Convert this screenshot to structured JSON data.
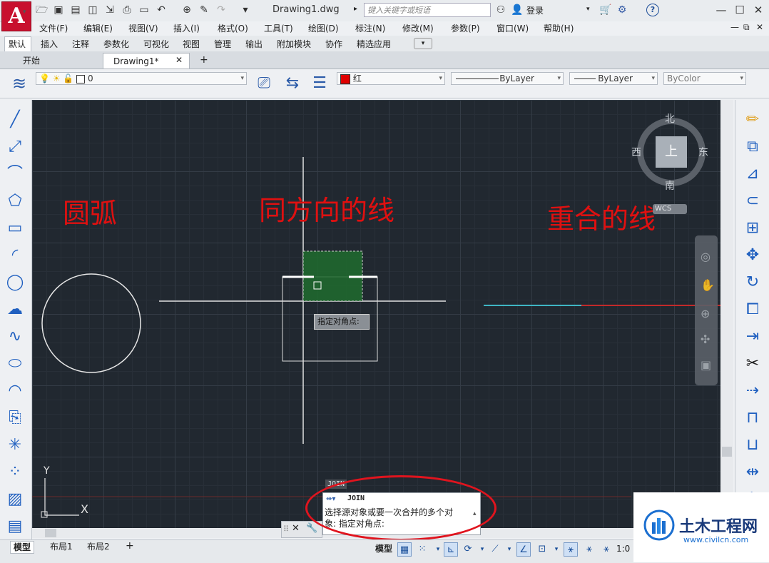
{
  "window": {
    "doc_title": "Drawing1.dwg",
    "search_placeholder": "键入关键字或短语",
    "login": "登录",
    "help": "?"
  },
  "app_logo": "A",
  "menu": [
    "文件(F)",
    "编辑(E)",
    "视图(V)",
    "插入(I)",
    "格式(O)",
    "工具(T)",
    "绘图(D)",
    "标注(N)",
    "修改(M)",
    "参数(P)",
    "窗口(W)",
    "帮助(H)"
  ],
  "ribbon_tabs": [
    "默认",
    "插入",
    "注释",
    "参数化",
    "可视化",
    "视图",
    "管理",
    "输出",
    "附加模块",
    "协作",
    "精选应用"
  ],
  "file_tabs": {
    "start": "开始",
    "drawing": "Drawing1*",
    "new_tab": "+"
  },
  "properties": {
    "layer": "0",
    "color": "红",
    "color_swatch": "#e00000",
    "linetype": "ByLayer",
    "lineweight": "ByLayer",
    "plotstyle": "ByColor"
  },
  "canvas": {
    "label_arc": "圆弧",
    "label_same_direction": "同方向的线",
    "label_overlap": "重合的线",
    "tooltip": "指定对角点:",
    "ucs_y": "Y",
    "ucs_x": "X"
  },
  "viewcube": {
    "north": "北",
    "south": "南",
    "west": "西",
    "east": "东",
    "top": "上",
    "wcs": "WCS"
  },
  "command": {
    "label": "JOIN",
    "prompt_cmd": "JOIN",
    "prompt_line1": "选择源对象或要一次合并的多个对",
    "prompt_line2": "象: 指定对角点:"
  },
  "layout_tabs": [
    "模型",
    "布局1",
    "布局2"
  ],
  "status": {
    "model": "模型",
    "scale": "1:0"
  },
  "watermark": {
    "name": "土木工程网",
    "url": "www.civilcn.com"
  }
}
